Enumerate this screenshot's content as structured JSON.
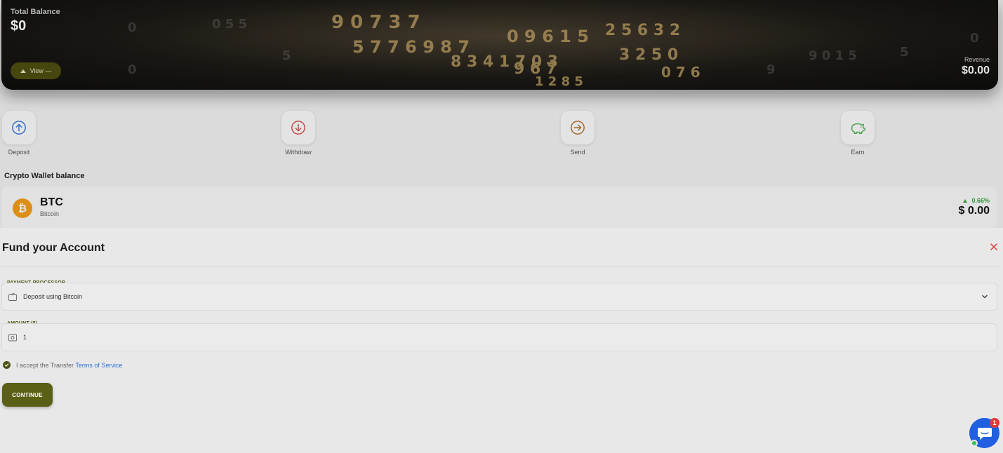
{
  "background": {
    "hero": {
      "total_balance_label": "Total Balance",
      "total_balance_value": "$0",
      "view_label": "View —",
      "revenue_label": "Revenue",
      "revenue_value": "$0.00"
    },
    "actions": [
      {
        "label": "Deposit",
        "icon": "arrow-up-circle-icon",
        "color": "#3a7bd5"
      },
      {
        "label": "Withdraw",
        "icon": "arrow-down-circle-icon",
        "color": "#d9534f"
      },
      {
        "label": "Send",
        "icon": "arrow-right-circle-icon",
        "color": "#b87333"
      },
      {
        "label": "Earn",
        "icon": "piggy-bank-icon",
        "color": "#4caf50"
      }
    ],
    "wallet_heading": "Crypto Wallet balance",
    "wallet": {
      "symbol": "BTC",
      "name": "Bitcoin",
      "change": "0.66%",
      "value": "$ 0.00",
      "logo_glyph": "₿"
    }
  },
  "modal": {
    "title": "Fund your Account",
    "payment_label": "PAYMENT PROCESSOR",
    "payment_value": "Deposit using Bitcoin",
    "amount_label": "AMOUNT ($)",
    "amount_value": "1",
    "terms_prefix": "I accept the Transfer",
    "terms_link": "Terms of Service",
    "continue_label": "CONTINUE"
  },
  "chat": {
    "badge_count": "1"
  },
  "colors": {
    "accent": "#5a5f16",
    "close": "#e23a3a",
    "link": "#2a6fd6"
  }
}
